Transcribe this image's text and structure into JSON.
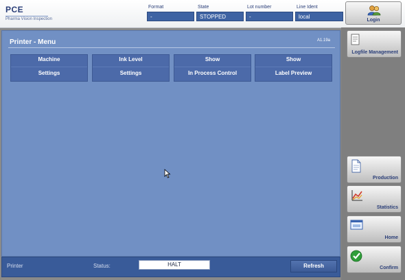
{
  "header": {
    "logo_title": "PCE",
    "logo_subtitle": "Pharma Vision Inspection",
    "fields": [
      {
        "label": "Format",
        "value": "-"
      },
      {
        "label": "State",
        "value": "STOPPED"
      },
      {
        "label": "Lot number",
        "value": "-"
      },
      {
        "label": "Line Ident",
        "value": "local"
      }
    ],
    "login_label": "Login"
  },
  "panel": {
    "title": "Printer - Menu",
    "version": "A1.19a",
    "buttons": [
      {
        "line1": "Machine",
        "line2": "Settings"
      },
      {
        "line1": "Ink Level",
        "line2": "Settings"
      },
      {
        "line1": "Show",
        "line2": "In Process Control"
      },
      {
        "line1": "Show",
        "line2": "Label Preview"
      }
    ]
  },
  "statusbar": {
    "printer_label": "Printer",
    "status_label": "Status:",
    "status_value": "HALT",
    "refresh_label": "Refresh"
  },
  "sidebar": {
    "items": [
      {
        "label": "Logfile Management",
        "icon": "logfile-icon"
      },
      {
        "label": "Production",
        "icon": "document-icon"
      },
      {
        "label": "Statistics",
        "icon": "chart-icon"
      },
      {
        "label": "Home",
        "icon": "window-icon"
      },
      {
        "label": "Confirm",
        "icon": "checkmark-icon"
      }
    ]
  },
  "colors": {
    "panel": "#7190c4",
    "button": "#4c6aa9",
    "statusbar": "#395b99",
    "accent_text": "#2a3e78"
  }
}
